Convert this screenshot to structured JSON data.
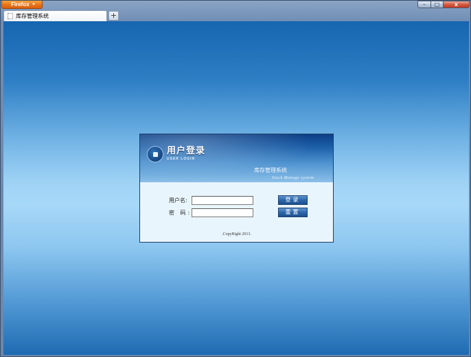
{
  "browser": {
    "menu_button_label": "Firefox",
    "window_controls": {
      "minimize": "–",
      "maximize": "□",
      "close": "x"
    },
    "tab": {
      "title": "库存管理系统",
      "favicon": "blank-page-icon"
    },
    "new_tab_label": "+"
  },
  "login": {
    "title": "用户登录",
    "subtitle": "USER LOGIN",
    "system_name": "库存管理系统",
    "system_name_en": "Stock Manage system",
    "username_label": "用户名:",
    "username_value": "",
    "password_label": "密 码:",
    "password_value": "",
    "login_button": "登录",
    "reset_button": "重置",
    "copyright": ".CopyRight 2013."
  },
  "colors": {
    "page_top": "#1565b0",
    "page_middle": "#a7d8f8",
    "panel_header": "#1b5da6",
    "panel_body": "#e9f5fc",
    "button": "#2d67aa",
    "firefox_orange": "#e8731b"
  }
}
